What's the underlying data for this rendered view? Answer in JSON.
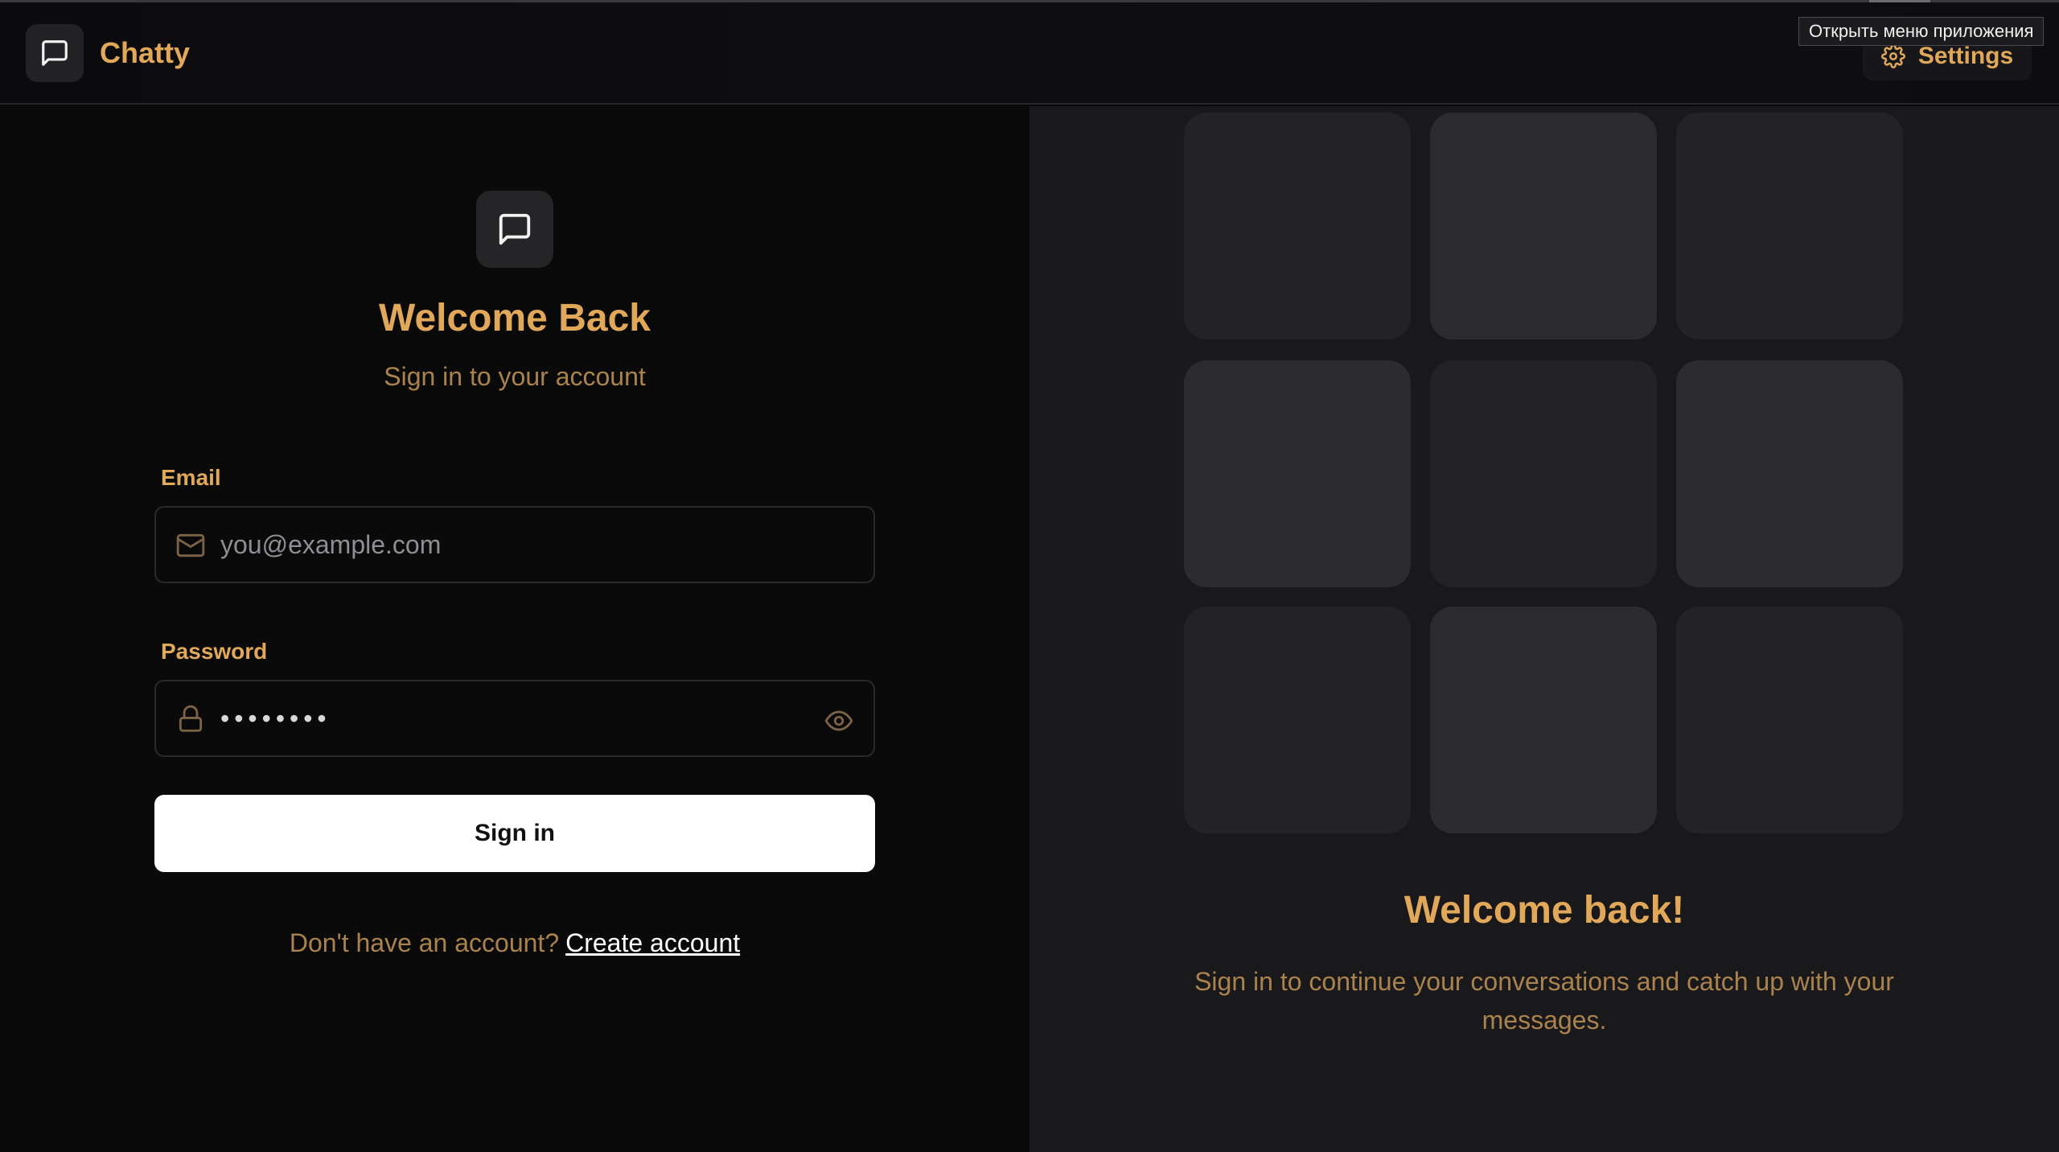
{
  "app": {
    "name": "Chatty"
  },
  "header": {
    "settings_label": "Settings",
    "tooltip": "Открыть меню приложения"
  },
  "login": {
    "title": "Welcome Back",
    "subtitle": "Sign in to your account",
    "email_label": "Email",
    "email_placeholder": "you@example.com",
    "password_label": "Password",
    "password_value": "••••••••",
    "submit_label": "Sign in",
    "signup_prompt": "Don't have an account?",
    "signup_link": "Create account"
  },
  "promo": {
    "title": "Welcome back!",
    "text": "Sign in to continue your conversations and catch up with your messages."
  },
  "colors": {
    "accent": "#e2a85a",
    "accent_muted": "#a9824e",
    "background": "#0a0a0b",
    "panel": "#19191b"
  },
  "icons": {
    "logo": "message-square-icon",
    "settings": "gear-icon",
    "email": "mail-icon",
    "password": "lock-icon",
    "reveal": "eye-icon"
  }
}
